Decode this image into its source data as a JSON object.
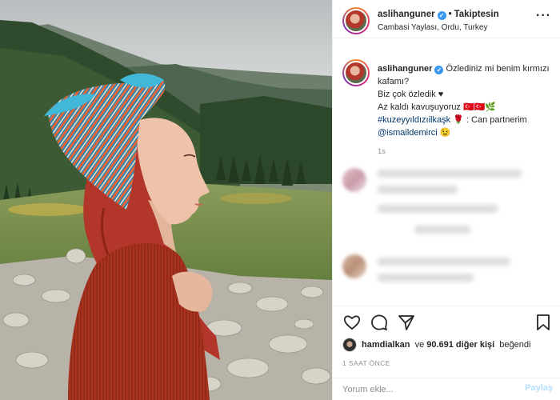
{
  "header": {
    "username": "aslihanguner",
    "verified_icon": "verified-badge-icon",
    "separator": "•",
    "follow_label": "Takiptesin",
    "location": "Cambasi Yaylası, Ordu, Turkey",
    "more_icon": "more-options-icon"
  },
  "caption": {
    "username": "aslihanguner",
    "lines": [
      "Özlediniz mi benim kırmızı kafamı?",
      "Biz çok özledik ♥",
      "Az kaldı kavuşuyoruz 🇹🇷🇹🇷🌿"
    ],
    "hashtag": "#kuzeyyıldızıilkaşk",
    "hashtag_suffix": "🌹 : Can partnerim",
    "mention": "@ismaildemirci",
    "mention_emoji": "😉",
    "time": "1s"
  },
  "actions": {
    "like_icon": "heart-icon",
    "comment_icon": "comment-icon",
    "share_icon": "share-icon",
    "save_icon": "bookmark-icon"
  },
  "likes": {
    "liker": "hamdialkan",
    "connector": "ve",
    "count_text": "90.691 diğer kişi",
    "suffix": "beğendi"
  },
  "time_ago": "1 SAAT ÖNCE",
  "comment_box": {
    "placeholder": "Yorum ekle...",
    "post_label": "Paylaş"
  },
  "colors": {
    "link": "#00376b",
    "verified": "#3897f0",
    "post_disabled": "#b2dffc",
    "hair": "#b3362a"
  }
}
